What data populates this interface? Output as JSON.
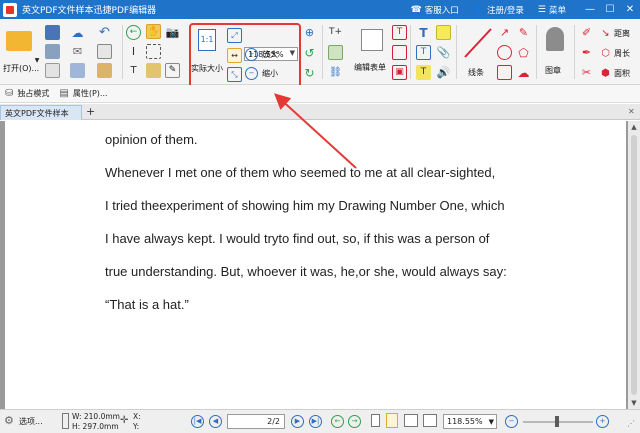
{
  "titlebar": {
    "title": "英文PDF文件样本迅捷PDF编辑器",
    "service": "客服入口",
    "login": "注册/登录",
    "menu": "菜单",
    "minimize": "—",
    "maximize": "☐",
    "close": "✕"
  },
  "ribbon": {
    "open_label": "打开(O)...",
    "actual_size_label": "实际大小",
    "zoom_value": "118.55%",
    "zoom_in_label": "放大",
    "zoom_out_label": "缩小",
    "edit_form_label": "编辑表单",
    "line_label": "线条",
    "stamp_label": "图章",
    "distance_label": "距离",
    "perimeter_label": "周长",
    "area_label": "面积"
  },
  "subbar": {
    "solo_mode": "独占模式",
    "properties": "属性(P)..."
  },
  "tabs": {
    "document_tab": "英文PDF文件样本",
    "add": "+",
    "close": "✕"
  },
  "document": {
    "lines": [
      "opinion of them.",
      "Whenever I met one of them who seemed to me at all clear-sighted,",
      "I tried theexperiment of showing him my Drawing Number One, which",
      "I have always kept. I would tryto find out, so,     if this was a person of",
      "true understanding. But, whoever it was,     he,or she, would always say:",
      "“That is a hat.”"
    ]
  },
  "statusbar": {
    "options": "选项...",
    "width": "W: 210.0mm",
    "height": "H: 297.0mm",
    "x_readout": "X:",
    "y_readout": "Y:",
    "page_value": "2/2",
    "zoom_value": "118.55%"
  },
  "colors": {
    "titlebar": "#1f73c8",
    "highlight": "#e53935",
    "accent_blue": "#2d6fc4"
  }
}
